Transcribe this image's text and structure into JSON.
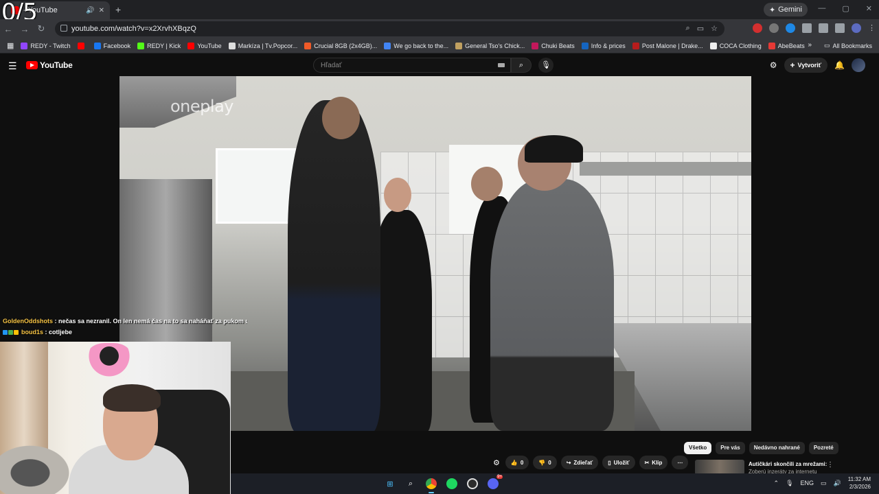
{
  "overlay": {
    "counter": "0/5"
  },
  "browser": {
    "tab_title": "- YouTube",
    "new_tab": "+",
    "gemini_label": "Gemini",
    "url": "youtube.com/watch?v=x2XrvhXBqzQ",
    "bookmarks": [
      {
        "label": "REDY - Twitch",
        "color": "#9146ff"
      },
      {
        "label": "",
        "color": "#ff0000"
      },
      {
        "label": "Facebook",
        "color": "#1877f2"
      },
      {
        "label": "REDY | Kick",
        "color": "#53fc18"
      },
      {
        "label": "YouTube",
        "color": "#ff0000"
      },
      {
        "label": "Markíza | Tv.Popcor...",
        "color": "#dddddd"
      },
      {
        "label": "Crucial 8GB (2x4GB)...",
        "color": "#f05a28"
      },
      {
        "label": "We go back to the...",
        "color": "#4285f4"
      },
      {
        "label": "General Tso's Chick...",
        "color": "#c0a060"
      },
      {
        "label": "Chuki Beats",
        "color": "#c2185b"
      },
      {
        "label": "Info & prices",
        "color": "#1565c0"
      },
      {
        "label": "Post Malone | Drake...",
        "color": "#b71c1c"
      },
      {
        "label": "COCA Clothing",
        "color": "#eeeeee"
      },
      {
        "label": "AbeBeats",
        "color": "#e53935"
      }
    ],
    "all_bookmarks": "All Bookmarks",
    "more_bookmarks": "»"
  },
  "youtube": {
    "logo_text": "YouTube",
    "search_placeholder": "Hľadať",
    "create_label": "Vytvoriť",
    "watermark": "oneplay",
    "likes": "0",
    "dislikes": "0",
    "share_label": "Zdieľať",
    "save_label": "Uložiť",
    "clip_label": "Klip",
    "chips": [
      "Všetko",
      "Pre vás",
      "Nedávno nahrané",
      "Pozreté"
    ],
    "rec_title": "Autičkári skončili za mrežami:",
    "rec_subtitle": "Zoberú inzeráty za internetu"
  },
  "chat": [
    {
      "user": "GoldenOddshots",
      "color": "#f6c344",
      "message": "nečas sa nezranil. On len nemá čas na to sa naháňať za pukom už"
    },
    {
      "user": "boud1s",
      "color": "#f6c344",
      "message": "cotljebe"
    }
  ],
  "taskbar": {
    "language": "ENG",
    "time": "11:32 AM",
    "date": "2/3/2026",
    "discord_badge": "9+"
  },
  "colors": {
    "yt_red": "#ff0000",
    "bg": "#0f0f0f",
    "chrome_tab": "#35363a"
  }
}
